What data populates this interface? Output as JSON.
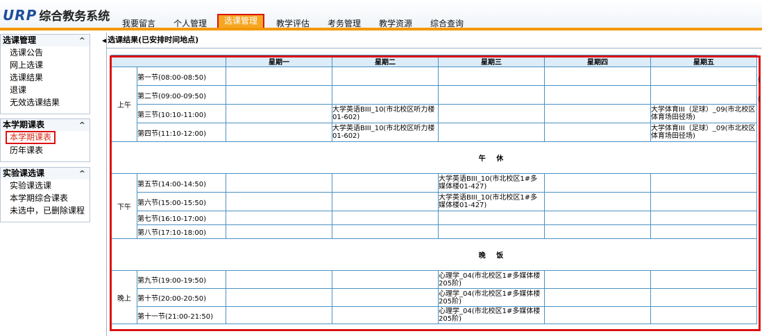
{
  "header": {
    "logo_brand": "URP",
    "logo_system": "综合教务系统",
    "nav": [
      "我要留言",
      "个人管理",
      "选课管理",
      "教学评估",
      "考务管理",
      "教学资源",
      "综合查询"
    ]
  },
  "sidebar": {
    "groups": [
      {
        "title": "选课管理",
        "items": [
          "选课公告",
          "网上选课",
          "选课结果",
          "退课",
          "无效选课结果"
        ]
      },
      {
        "title": "本学期课表",
        "items": [
          "本学期课表",
          "历年课表"
        ]
      },
      {
        "title": "实验课选课",
        "items": [
          "实验课选课",
          "本学期综合课表",
          "未选中，已删除课程"
        ]
      }
    ],
    "collapse_glyph": "^"
  },
  "content": {
    "breadcrumb": "选课结果(已安排时间地点)",
    "days": [
      "星期一",
      "星期二",
      "星期三",
      "星期四",
      "星期五"
    ],
    "sections": {
      "am": "上午",
      "pm": "下午",
      "eve": "晚上"
    },
    "breaks": {
      "noon": "午 休",
      "dinner": "晚 饭"
    },
    "periods": [
      "第一节(08:00-08:50)",
      "第二节(09:00-09:50)",
      "第三节(10:10-11:00)",
      "第四节(11:10-12:00)",
      "第五节(14:00-14:50)",
      "第六节(15:00-15:50)",
      "第七节(16:10-17:00)",
      "第八节(17:10-18:00)",
      "第九节(19:00-19:50)",
      "第十节(20:00-20:50)",
      "第十一节(21:00-21:50)"
    ],
    "courses": {
      "p3_tue": "大学英语BIII_10(市北校区听力楼01-602)",
      "p4_tue": "大学英语BIII_10(市北校区听力楼01-602)",
      "p3_fri": "大学体育III（足球）_09(市北校区体育场田径场)",
      "p4_fri": "大学体育III（足球）_09(市北校区体育场田径场)",
      "p5_wed": "大学英语BIII_10(市北校区1#多媒体楼01-427)",
      "p6_wed": "大学英语BIII_10(市北校区1#多媒体楼01-427)",
      "p9_wed": "心理学_04(市北校区1#多媒体楼205阶)",
      "p10_wed": "心理学_04(市北校区1#多媒体楼205阶)",
      "p11_wed": "心理学_04(市北校区1#多媒体楼205阶)"
    },
    "edge_chars": [
      "(",
      "("
    ]
  }
}
